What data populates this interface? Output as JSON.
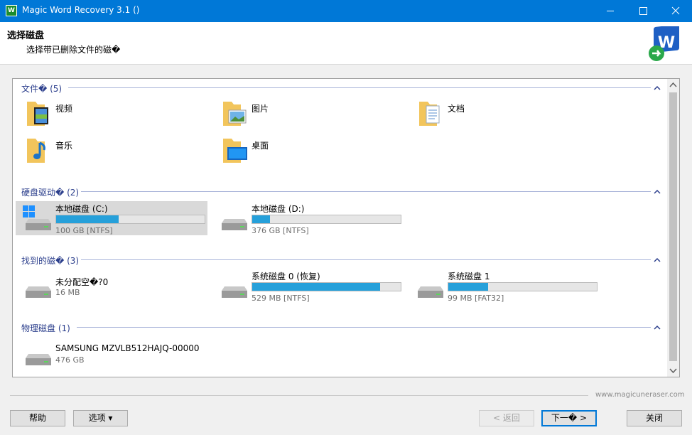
{
  "window": {
    "title": "Magic Word Recovery 3.1 ()"
  },
  "header": {
    "title": "选择磁盘",
    "subtitle": "选择带已删除文件的磁�"
  },
  "groups": {
    "folders": {
      "label": "文件� (5)",
      "items": [
        "视频",
        "图片",
        "文档",
        "音乐",
        "桌面"
      ]
    },
    "hard_drives": {
      "label": "硬盘驱动� (2)",
      "items": [
        {
          "name": "本地磁盘 (C:)",
          "size": "100 GB [NTFS]",
          "used_fraction": 0.42
        },
        {
          "name": "本地磁盘 (D:)",
          "size": "376 GB [NTFS]",
          "used_fraction": 0.12
        }
      ]
    },
    "found": {
      "label": "找到的磁� (3)",
      "items": [
        {
          "name": "未分配空�?0",
          "size": "16 MB"
        },
        {
          "name": "系统磁盘 0 (恢复)",
          "size": "529 MB [NTFS]",
          "used_fraction": 0.86
        },
        {
          "name": "系统磁盘 1",
          "size": "99 MB [FAT32]",
          "used_fraction": 0.27
        }
      ]
    },
    "physical": {
      "label": "物理磁盘 (1)",
      "items": [
        {
          "name": "SAMSUNG MZVLB512HAJQ-00000",
          "size": "476 GB"
        }
      ]
    }
  },
  "footer": {
    "website": "www.magicuneraser.com",
    "help": "帮助",
    "options": "选项 ▾",
    "back": "< 返回",
    "next": "下一� >",
    "close": "关闭"
  },
  "colors": {
    "titlebar": "#0078d7",
    "group_text": "#2b3e8c",
    "bar_fill": "#26a0da"
  }
}
